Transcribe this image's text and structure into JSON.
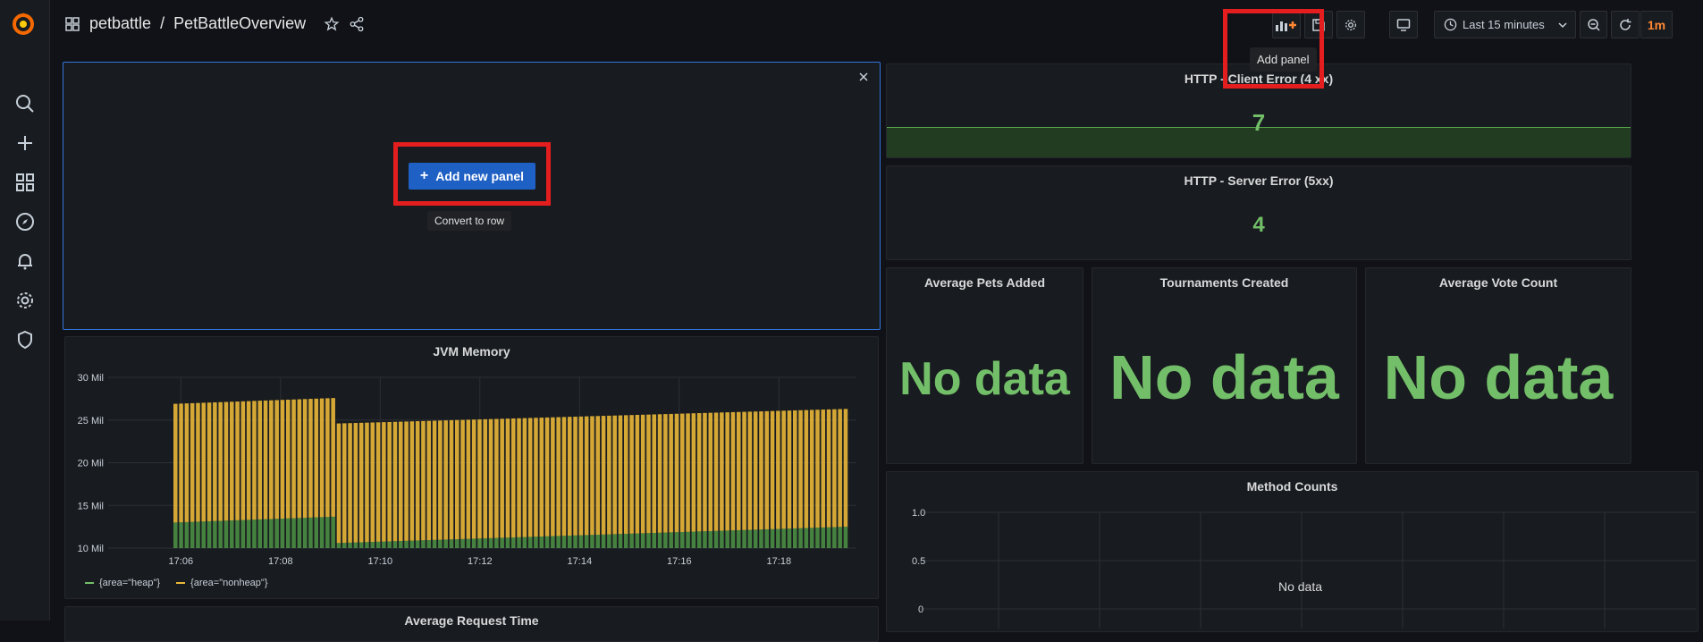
{
  "breadcrumb": {
    "folder": "petbattle",
    "separator": "/",
    "dashboard": "PetBattleOverview"
  },
  "toolbar": {
    "time_range": "Last 15 minutes",
    "refresh_interval": "1m",
    "add_panel_tooltip": "Add panel"
  },
  "new_panel": {
    "add_button": "Add new panel",
    "add_button_icon": "+",
    "convert_row_tooltip": "Convert to row"
  },
  "panels": {
    "client_error": {
      "title": "HTTP - Client Error (4 xx)",
      "value": "7"
    },
    "server_error": {
      "title": "HTTP - Server Error (5xx)",
      "value": "4"
    },
    "avg_pets": {
      "title": "Average Pets Added",
      "value": "No data"
    },
    "tournaments": {
      "title": "Tournaments Created",
      "value": "No data"
    },
    "avg_votes": {
      "title": "Average Vote Count",
      "value": "No data"
    },
    "method_counts": {
      "title": "Method Counts",
      "no_data": "No data",
      "y_ticks": [
        "1.0",
        "0.5",
        "0"
      ]
    },
    "jvm": {
      "title": "JVM Memory",
      "legend": [
        "{area=\"heap\"}",
        "{area=\"nonheap\"}"
      ],
      "y_ticks": [
        "30 Mil",
        "25 Mil",
        "20 Mil",
        "15 Mil",
        "10 Mil"
      ],
      "x_ticks": [
        "17:06",
        "17:08",
        "17:10",
        "17:12",
        "17:14",
        "17:16",
        "17:18"
      ]
    },
    "avg_request": {
      "title": "Average Request Time"
    }
  },
  "colors": {
    "accent": "#73bf69",
    "nonheap": "#eab839",
    "button": "#1f60c4",
    "highlight": "#e41e1e"
  },
  "icons": [
    "grafana-logo",
    "search-icon",
    "plus-icon",
    "dashboards-icon",
    "explore-icon",
    "bell-icon",
    "gear-icon",
    "shield-icon",
    "apps-icon",
    "star-icon",
    "share-icon",
    "add-panel-icon",
    "save-icon",
    "settings-icon",
    "tv-icon",
    "clock-icon",
    "chevron-down-icon",
    "zoom-out-icon",
    "refresh-icon",
    "close-icon"
  ],
  "chart_data": {
    "type": "bar",
    "title": "JVM Memory",
    "x": [
      "17:05",
      "17:06",
      "17:07",
      "17:08",
      "17:08",
      "17:09",
      "17:10",
      "17:11",
      "17:12",
      "17:13",
      "17:14",
      "17:15",
      "17:16",
      "17:17",
      "17:18",
      "17:19"
    ],
    "series": [
      {
        "name": "{area=\"heap\"}",
        "values": [
          13.0,
          13.2,
          13.4,
          13.7,
          10.6,
          10.7,
          10.9,
          11.1,
          11.2,
          11.4,
          11.6,
          11.7,
          11.9,
          12.1,
          12.4,
          12.5
        ]
      },
      {
        "name": "{area=\"nonheap\"}",
        "values": [
          13.9,
          13.9,
          13.9,
          13.9,
          14.0,
          14.0,
          14.0,
          14.0,
          14.0,
          14.0,
          14.0,
          14.0,
          14.0,
          14.0,
          13.9,
          13.8
        ]
      }
    ],
    "stacked": true,
    "ylim": [
      10,
      30
    ],
    "y_unit": "Mil"
  }
}
